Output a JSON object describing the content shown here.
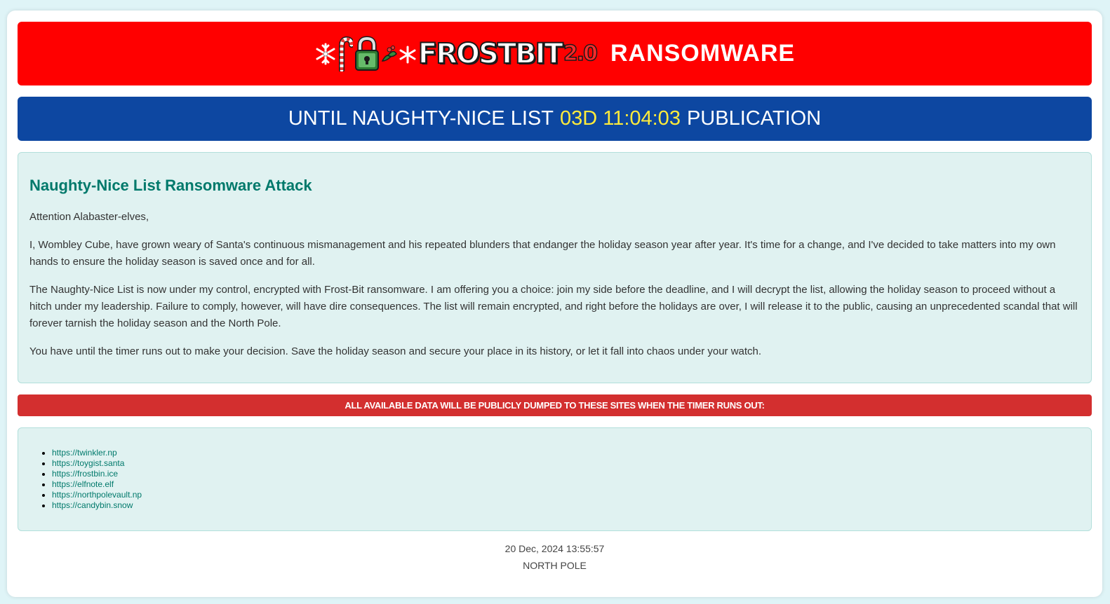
{
  "header": {
    "logo_text": "FROSTBIT",
    "logo_version": "2.0",
    "title": "RANSOMWARE"
  },
  "timer": {
    "prefix": "UNTIL NAUGHTY-NICE LIST",
    "countdown": "03D 11:04:03",
    "suffix": "PUBLICATION"
  },
  "message": {
    "heading": "Naughty-Nice List Ransomware Attack",
    "paragraphs": [
      "Attention Alabaster-elves,",
      "I, Wombley Cube, have grown weary of Santa's continuous mismanagement and his repeated blunders that endanger the holiday season year after year. It's time for a change, and I've decided to take matters into my own hands to ensure the holiday season is saved once and for all.",
      "The Naughty-Nice List is now under my control, encrypted with Frost-Bit ransomware. I am offering you a choice: join my side before the deadline, and I will decrypt the list, allowing the holiday season to proceed without a hitch under my leadership. Failure to comply, however, will have dire consequences. The list will remain encrypted, and right before the holidays are over, I will release it to the public, causing an unprecedented scandal that will forever tarnish the holiday season and the North Pole.",
      "You have until the timer runs out to make your decision. Save the holiday season and secure your place in its history, or let it fall into chaos under your watch."
    ]
  },
  "warning": "ALL AVAILABLE DATA WILL BE PUBLICLY DUMPED TO THESE SITES WHEN THE TIMER RUNS OUT:",
  "sites": [
    "https://twinkler.np",
    "https://toygist.santa",
    "https://frostbin.ice",
    "https://elfnote.elf",
    "https://northpolevault.np",
    "https://candybin.snow"
  ],
  "footer": {
    "timestamp": "20 Dec, 2024 13:55:57",
    "location": "NORTH POLE"
  },
  "colors": {
    "header_bg": "#ff0000",
    "timer_bg": "#0d47a1",
    "countdown": "#ffeb3b",
    "heading": "#00796b",
    "warning_bg": "#d32f2f",
    "panel_bg": "#e0f2f1"
  },
  "icons": [
    "snowflake-icon",
    "candy-cane-icon",
    "padlock-icon",
    "holly-icon",
    "snowflake-icon"
  ]
}
